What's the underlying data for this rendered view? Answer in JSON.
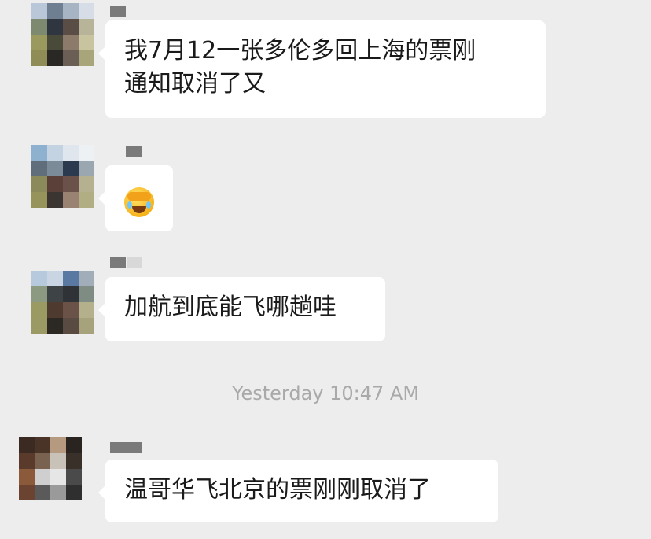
{
  "messages": [
    {
      "text": "我7月12一张多伦多回上海的票刚\n通知取消了又"
    },
    {
      "emoji": "face-with-hand-over-eyes-emoji"
    },
    {
      "text": "加航到底能飞哪趟哇"
    },
    {
      "text": "温哥华飞北京的票刚刚取消了"
    }
  ],
  "timestamp": "Yesterday 10:47 AM"
}
